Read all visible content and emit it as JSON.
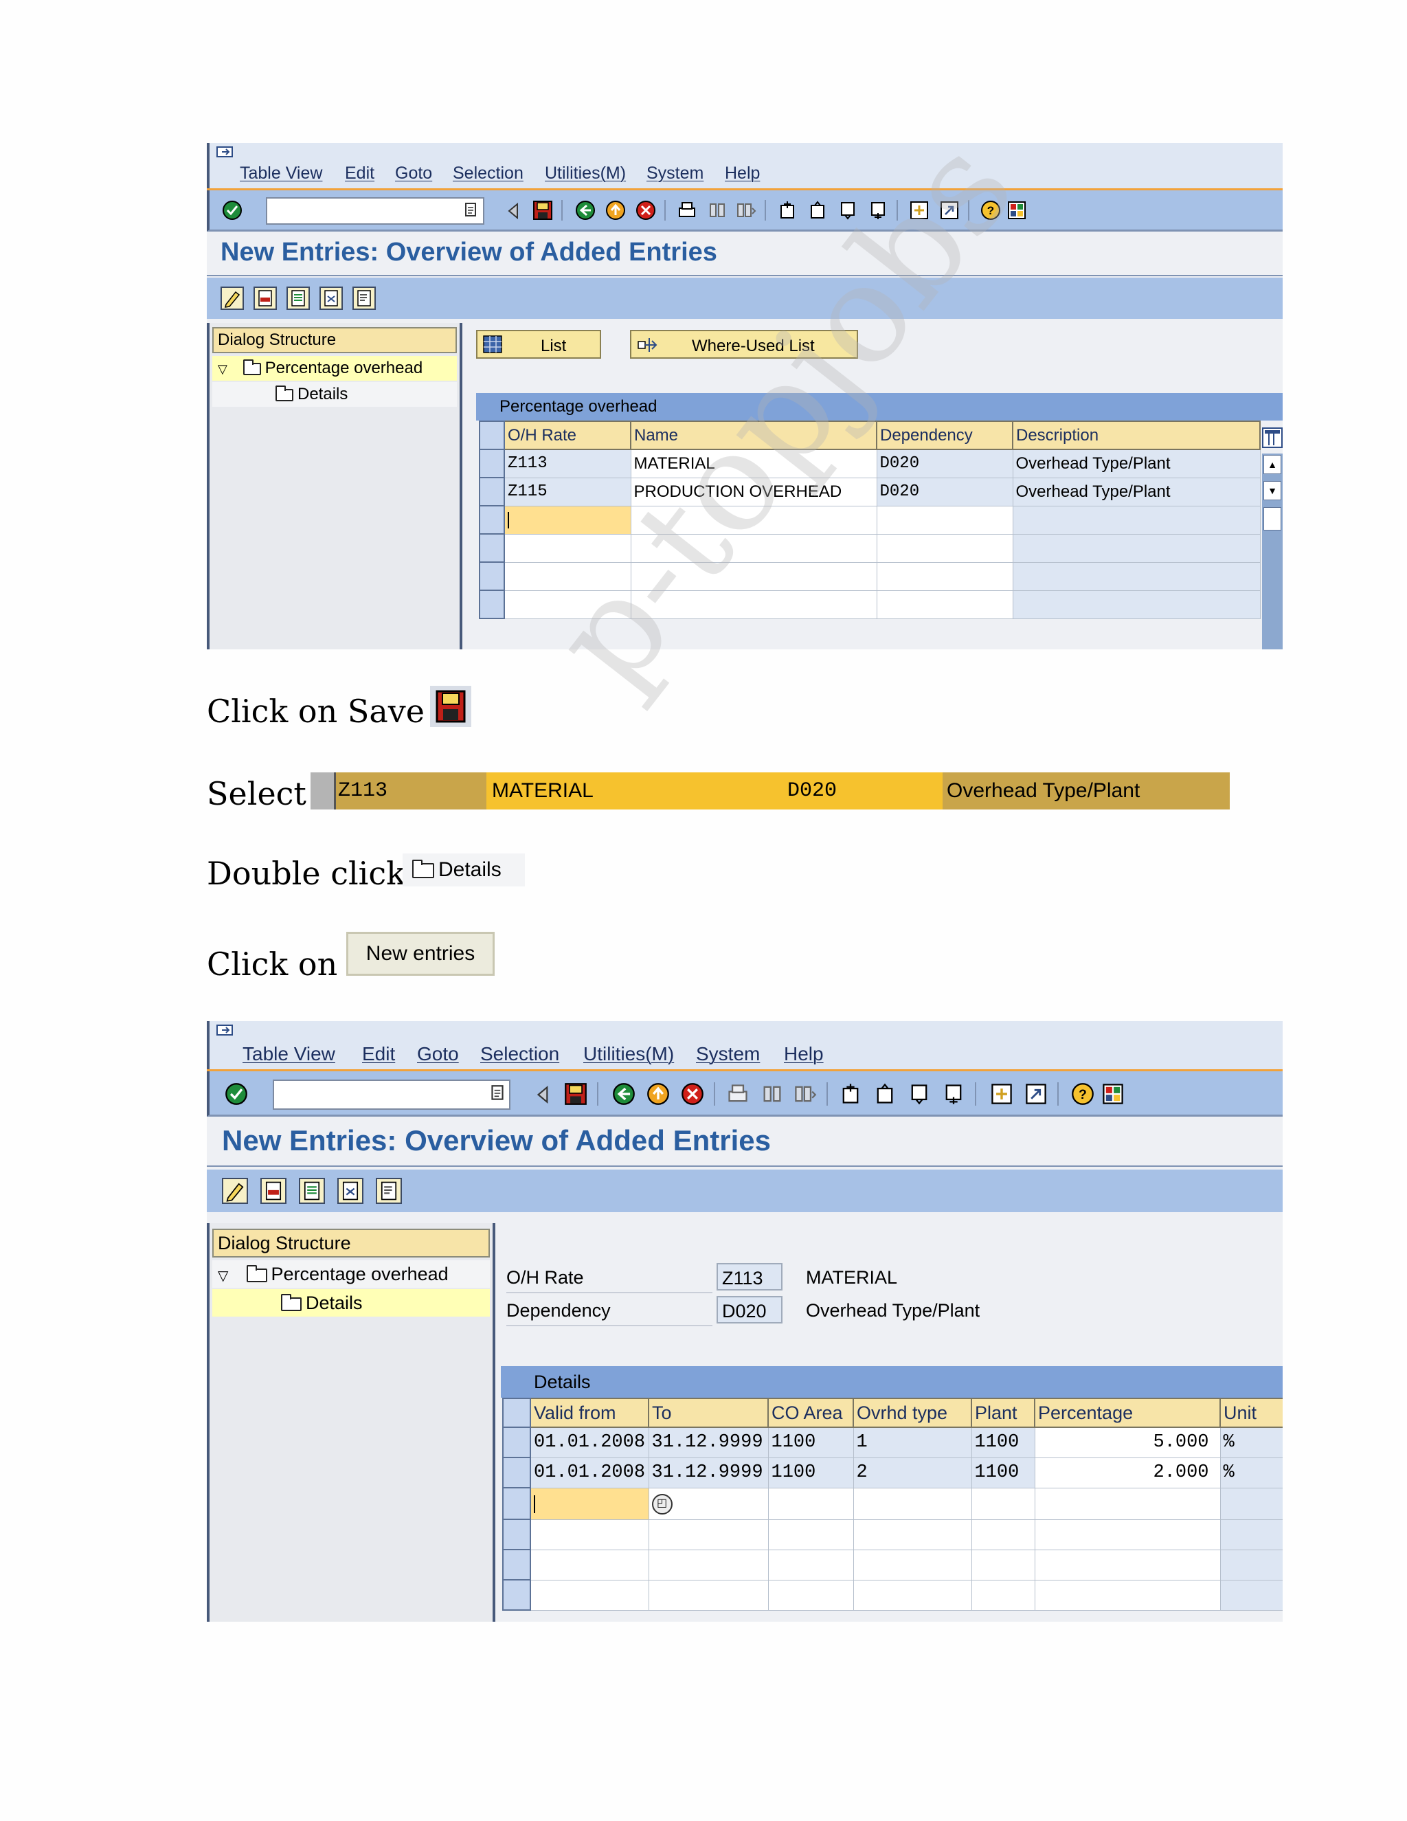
{
  "screen1": {
    "menu": [
      "Table View",
      "Edit",
      "Goto",
      "Selection",
      "Utilities(M)",
      "System",
      "Help"
    ],
    "title": "New Entries: Overview of Added Entries",
    "tree": {
      "heading": "Dialog Structure",
      "items": [
        {
          "label": "Percentage overhead",
          "selected": true
        },
        {
          "label": "Details",
          "selected": false
        }
      ]
    },
    "buttons": {
      "list": "List",
      "where_used": "Where-Used List"
    },
    "grid": {
      "title": "Percentage overhead",
      "columns": [
        "O/H Rate",
        "Name",
        "Dependency",
        "Description"
      ],
      "rows": [
        [
          "Z113",
          "MATERIAL",
          "D020",
          "Overhead Type/Plant"
        ],
        [
          "Z115",
          "PRODUCTION OVERHEAD",
          "D020",
          "Overhead Type/Plant"
        ]
      ]
    }
  },
  "steps": {
    "save": "Click on Save",
    "select": "Select",
    "select_row": [
      "Z113",
      "MATERIAL",
      "D020",
      "Overhead Type/Plant"
    ],
    "double_click": "Double click",
    "details_label": "Details",
    "click_on": "Click on",
    "new_entries": "New entries"
  },
  "screen2": {
    "menu": [
      "Table View",
      "Edit",
      "Goto",
      "Selection",
      "Utilities(M)",
      "System",
      "Help"
    ],
    "title": "New Entries: Overview of Added Entries",
    "tree": {
      "heading": "Dialog Structure",
      "items": [
        {
          "label": "Percentage overhead",
          "selected": false
        },
        {
          "label": "Details",
          "selected": true
        }
      ]
    },
    "header_fields": [
      {
        "label": "O/H Rate",
        "value": "Z113",
        "text": "MATERIAL"
      },
      {
        "label": "Dependency",
        "value": "D020",
        "text": "Overhead Type/Plant"
      }
    ],
    "grid": {
      "title": "Details",
      "columns": [
        "Valid from",
        "To",
        "CO Area",
        "Ovrhd type",
        "Plant",
        "Percentage",
        "Unit"
      ],
      "rows": [
        [
          "01.01.2008",
          "31.12.9999",
          "1100",
          "1",
          "1100",
          "5.000",
          "%"
        ],
        [
          "01.01.2008",
          "31.12.9999",
          "1100",
          "2",
          "1100",
          "2.000",
          "%"
        ]
      ]
    }
  },
  "watermark": "p-topjobs",
  "colors": {
    "title": "#2a5ea0",
    "toolbar": "#a7c1e6",
    "header_cell": "#f7e4a8",
    "select_row": "#f6c22e",
    "tree_highlight": "#ffffb6"
  }
}
